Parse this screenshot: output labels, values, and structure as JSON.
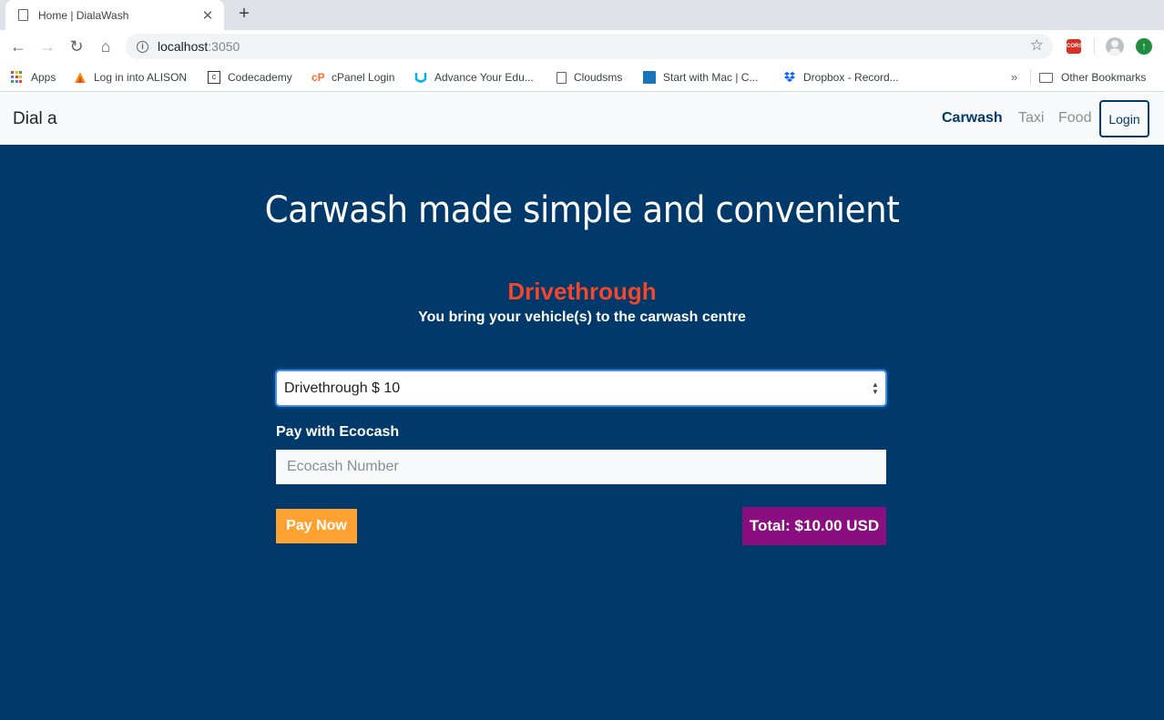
{
  "browser": {
    "tab_title": "Home | DialaWash",
    "url_host": "localhost",
    "url_port": ":3050",
    "bookmarks": [
      {
        "label": "Apps",
        "icon": "apps-grid-icon"
      },
      {
        "label": "Log in into ALISON",
        "icon": "alison-icon"
      },
      {
        "label": "Codecademy",
        "icon": "codecademy-icon"
      },
      {
        "label": "cPanel Login",
        "icon": "cpanel-icon"
      },
      {
        "label": "Advance Your Edu...",
        "icon": "udacity-icon"
      },
      {
        "label": "Cloudsms",
        "icon": "page-icon"
      },
      {
        "label": "Start with Mac | C...",
        "icon": "mac-icon"
      },
      {
        "label": "Dropbox - Record...",
        "icon": "dropbox-icon"
      }
    ],
    "other_bookmarks": "Other Bookmarks",
    "more_bookmarks": "»",
    "cors_ext_label": "CORS"
  },
  "navbar": {
    "brand": "Dial a",
    "links": [
      "Carwash",
      "Taxi",
      "Food"
    ],
    "login": "Login",
    "accent": "#01396b"
  },
  "hero": {
    "title": "Carwash made simple and convenient"
  },
  "service": {
    "title": "Drivethrough",
    "description": "You bring your vehicle(s) to the carwash centre",
    "title_color": "#f4462b"
  },
  "form": {
    "selected_option": "Drivethrough $ 10",
    "pay_label": "Pay with Ecocash",
    "ecocash_placeholder": "Ecocash Number",
    "pay_button": "Pay Now",
    "total": "Total: $10.00 USD",
    "pay_color": "#ffa232",
    "total_color": "#8a0e7f"
  }
}
